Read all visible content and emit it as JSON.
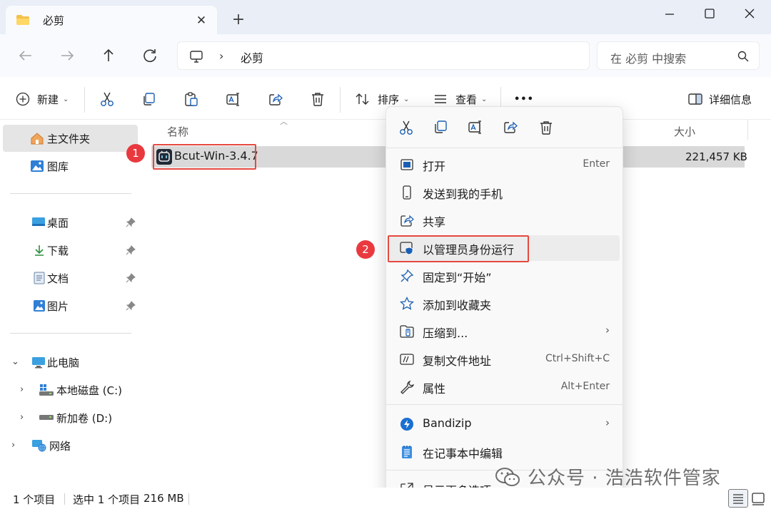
{
  "tab": {
    "title": "必剪",
    "close": "✕",
    "new": "+"
  },
  "address": {
    "chevron": "›",
    "path": "必剪"
  },
  "search": {
    "placeholder": "在 必剪 中搜索"
  },
  "toolbar": {
    "new_label": "新建",
    "sort_label": "排序",
    "view_label": "查看",
    "more_label": "•••",
    "details_label": "详细信息"
  },
  "sidebar": {
    "home": "主文件夹",
    "gallery": "图库",
    "desktop": "桌面",
    "downloads": "下载",
    "documents": "文档",
    "pictures": "图片",
    "this_pc": "此电脑",
    "local_c": "本地磁盘 (C:)",
    "volume_d": "新加卷 (D:)",
    "network": "网络"
  },
  "columns": {
    "name": "名称",
    "size": "大小"
  },
  "files": [
    {
      "name": "Bcut-Win-3.4.7",
      "size": "221,457 KB"
    }
  ],
  "badges": {
    "one": "1",
    "two": "2"
  },
  "context_menu": {
    "items": [
      {
        "label": "打开",
        "shortcut": "Enter",
        "icon": "open-icon"
      },
      {
        "label": "发送到我的手机",
        "icon": "phone-icon"
      },
      {
        "label": "共享",
        "icon": "share-icon"
      },
      {
        "label": "以管理员身份运行",
        "icon": "shield-icon"
      },
      {
        "label": "固定到“开始”",
        "icon": "pin-icon"
      },
      {
        "label": "添加到收藏夹",
        "icon": "star-icon"
      },
      {
        "label": "压缩到...",
        "submenu": "›",
        "icon": "zip-folder-icon"
      },
      {
        "label": "复制文件地址",
        "shortcut": "Ctrl+Shift+C",
        "icon": "copy-path-icon"
      },
      {
        "label": "属性",
        "shortcut": "Alt+Enter",
        "icon": "wrench-icon"
      },
      {
        "label": "Bandizip",
        "submenu": "›",
        "icon": "bandizip-icon"
      },
      {
        "label": "在记事本中编辑",
        "icon": "notepad-icon"
      },
      {
        "label": "显示更多选项",
        "icon": "more-options-icon"
      }
    ]
  },
  "status": {
    "count": "1 个项目",
    "selected": "选中 1 个项目",
    "size": "216 MB"
  },
  "watermark": "公众号 · 浩浩软件管家",
  "colors": {
    "accent": "#0f6cbd",
    "highlight_border": "#e5493f",
    "badge": "#e9393f"
  }
}
